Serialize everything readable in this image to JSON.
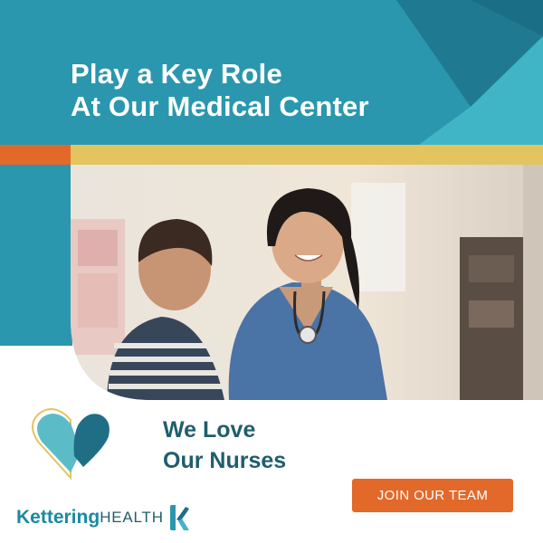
{
  "banner": {
    "headline_line1": "Play a Key Role",
    "headline_line2": "At Our Medical Center"
  },
  "photo": {
    "icon": "nurse-with-child-photo"
  },
  "tagline": {
    "line1": "We Love",
    "line2": "Our Nurses"
  },
  "cta": {
    "label": "JOIN OUR TEAM"
  },
  "logo": {
    "word1": "Kettering",
    "word2": "HEALTH",
    "mark_icon": "kettering-k-mark-icon"
  },
  "colors": {
    "teal": "#2a97ae",
    "dark_teal": "#1f5e6d",
    "gold": "#e3c45f",
    "orange": "#e2692a"
  }
}
